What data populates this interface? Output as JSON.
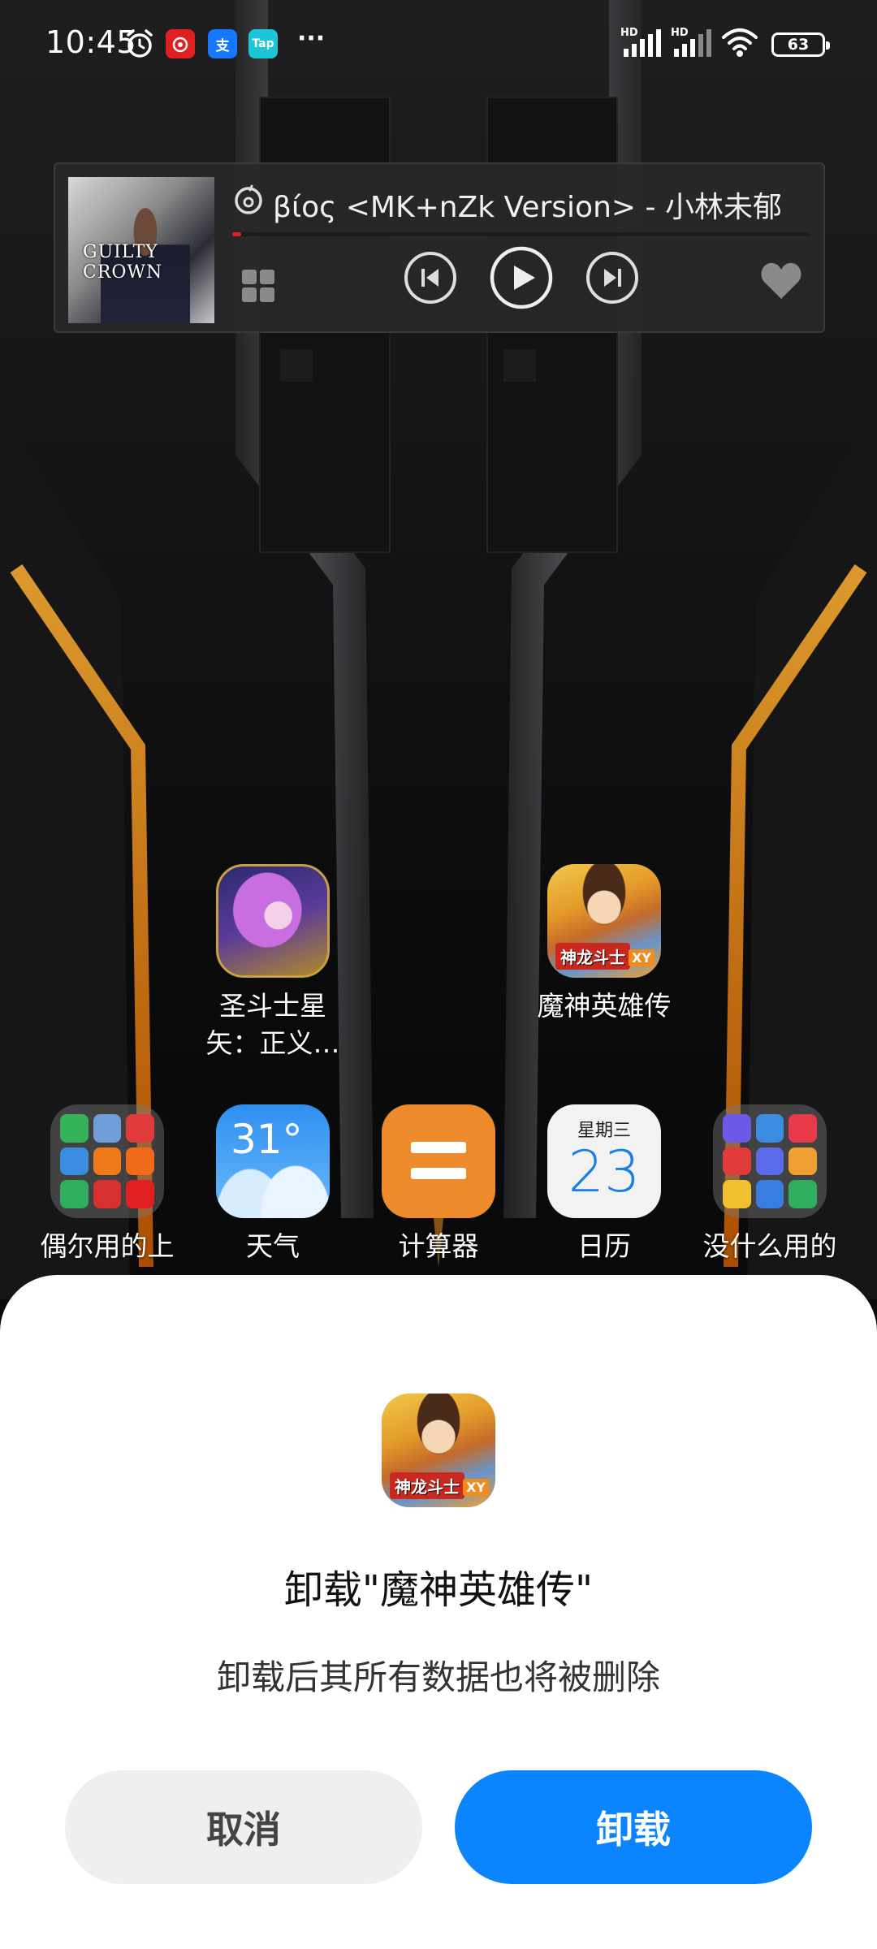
{
  "status_bar": {
    "time": "10:45",
    "battery": "63",
    "signal_label_1": "HD",
    "signal_label_2": "HD",
    "taptap_label": "Tap",
    "alipay_label": "支",
    "more_label": "···"
  },
  "music_widget": {
    "song_title": "βίος <MK+nZk Version> - 小林未郁",
    "album_text": "GUILTY CROWN",
    "progress": 0.015,
    "accent_color": "#e02020"
  },
  "home_apps": {
    "row1": [
      {
        "label_line1": "圣斗士星",
        "label_line2": "矢：正义…"
      },
      {
        "label_line1": "魔神英雄传",
        "label_line2": ""
      }
    ],
    "dock": [
      {
        "label": "偶尔用的上"
      },
      {
        "label": "天气",
        "temp": "31°"
      },
      {
        "label": "计算器"
      },
      {
        "label": "日历",
        "weekday": "星期三",
        "day": "23"
      },
      {
        "label": "没什么用的"
      }
    ],
    "game_tag": "神龙斗士",
    "game_xy": "XY"
  },
  "uninstall_sheet": {
    "title": "卸载\"魔神英雄传\"",
    "message": "卸载后其所有数据也将被删除",
    "cancel_label": "取消",
    "confirm_label": "卸载",
    "confirm_color": "#0a84ff"
  }
}
